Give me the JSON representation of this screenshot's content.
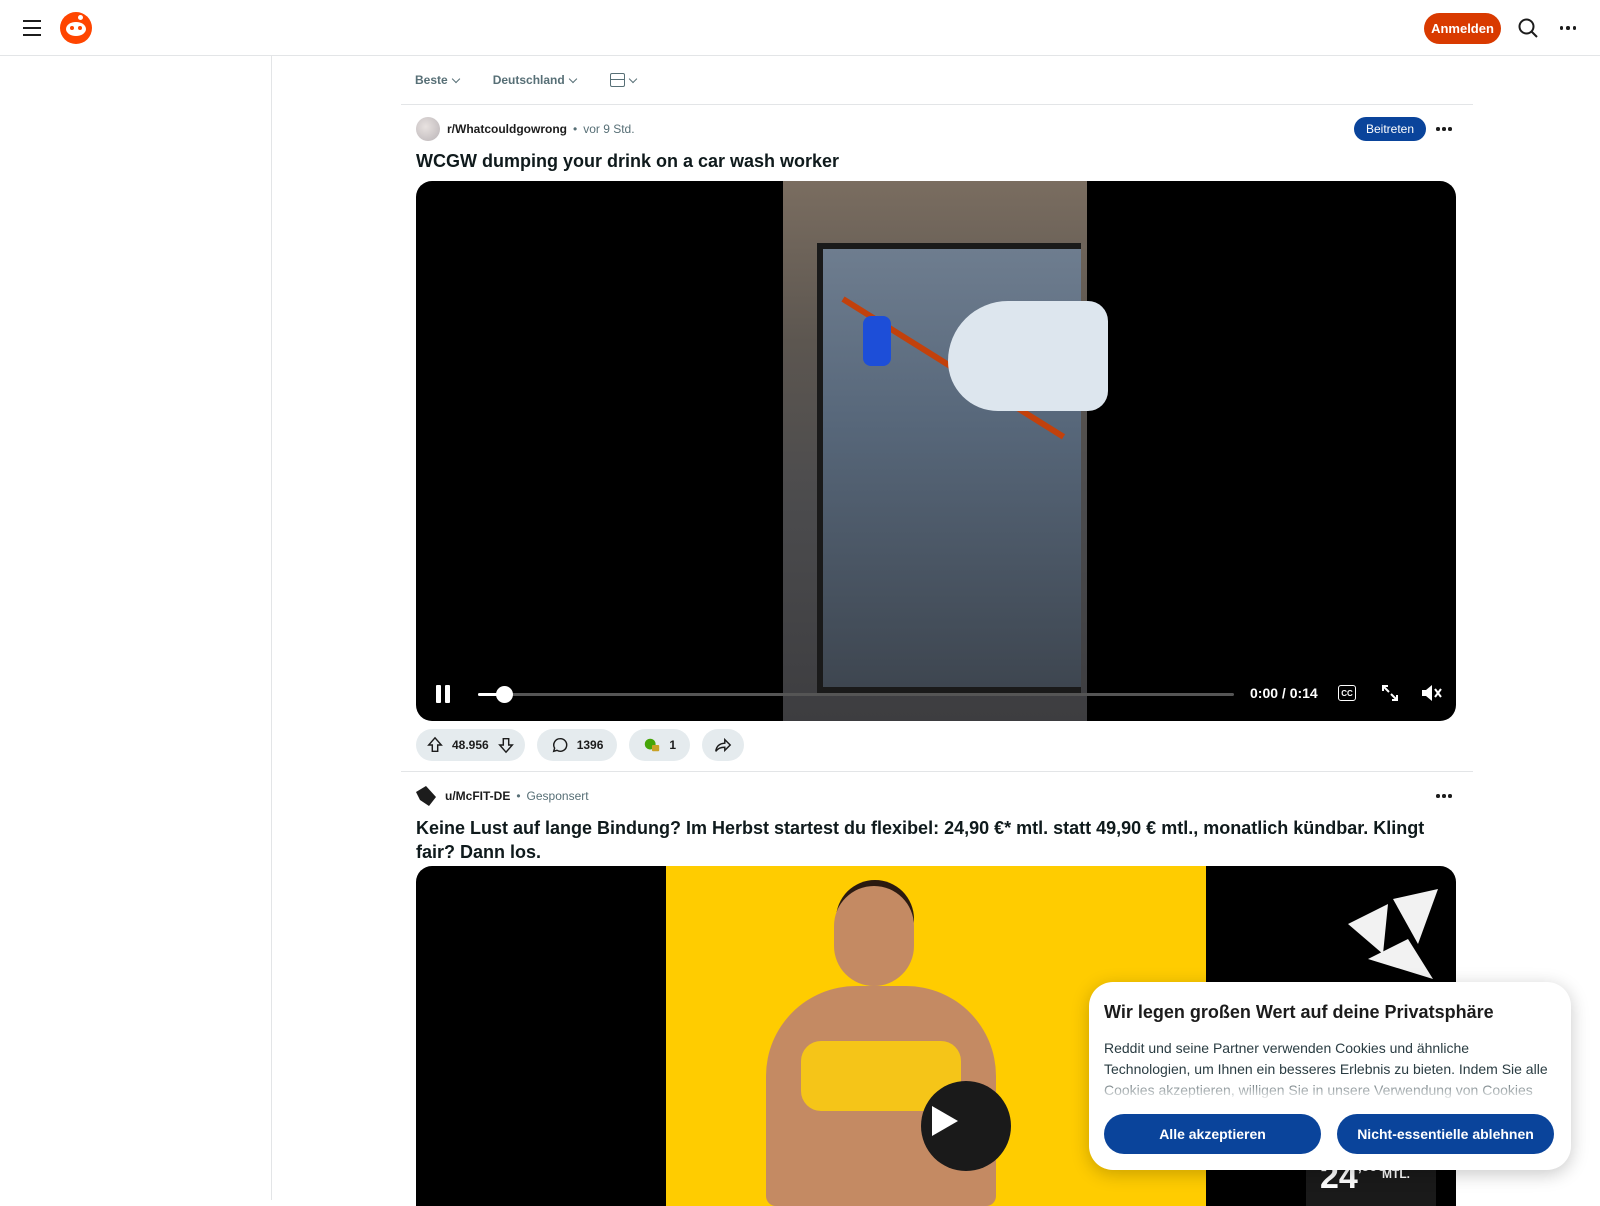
{
  "header": {
    "login_label": "Anmelden",
    "brand_color": "#ff4500",
    "login_color": "#d93a00"
  },
  "feed_controls": {
    "sort_label": "Beste",
    "region_label": "Deutschland"
  },
  "post1": {
    "subreddit": "r/Whatcouldgowrong",
    "separator": "•",
    "time": "vor 9 Std.",
    "join_label": "Beitreten",
    "title": "WCGW dumping your drink on a car wash worker",
    "video": {
      "time_display": "0:00 / 0:14",
      "cc_label": "CC",
      "progress": 0.0
    },
    "actions": {
      "votes": "48.956",
      "comments": "1396",
      "awards": "1"
    }
  },
  "post2": {
    "user": "u/McFIT-DE",
    "separator": "•",
    "sponsored_label": "Gesponsert",
    "title": "Keine Lust auf lange Bindung? Im Herbst startest du flexibel: 24,90 €* mtl. statt 49,90 € mtl., monatlich kündbar. Klingt fair? Dann los.",
    "ad_price_main": "24",
    "ad_price_sup": ",90€*",
    "ad_price_unit": "MTL."
  },
  "cookie_banner": {
    "title": "Wir legen großen Wert auf deine Privatsphäre",
    "body": "Reddit und seine Partner verwenden Cookies und ähnliche Technologien, um Ihnen ein besseres Erlebnis zu bieten. Indem Sie alle Cookies akzeptieren, willigen Sie in unsere Verwendung von Cookies ein, um",
    "accept_label": "Alle akzeptieren",
    "reject_label": "Nicht-essentielle ablehnen",
    "button_color": "#0a449b"
  }
}
